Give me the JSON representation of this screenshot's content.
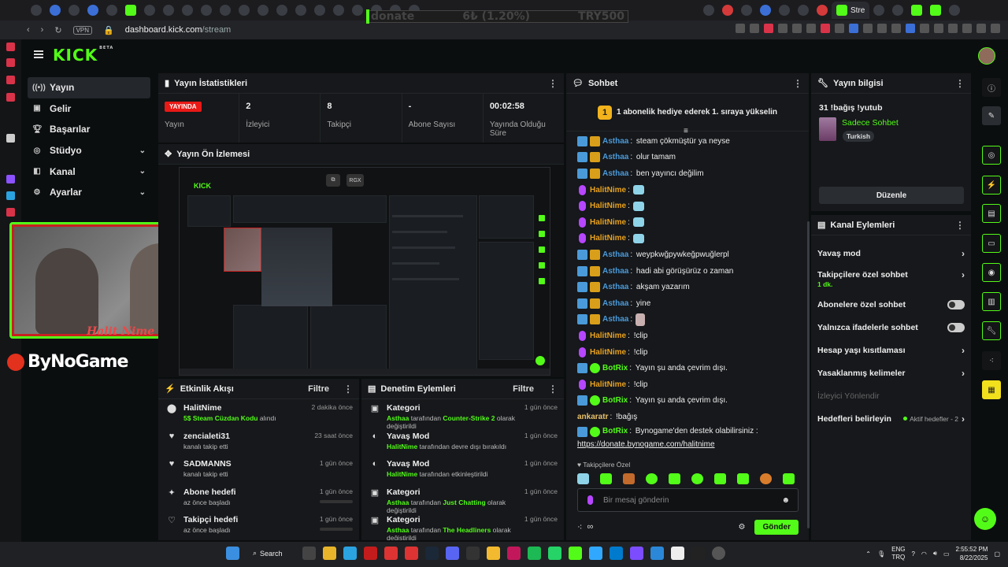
{
  "browser": {
    "donate_widget": {
      "label": "donate",
      "amount": "6₺ (1.20%)",
      "goal": "TRY500"
    },
    "active_tab_label": "Stre",
    "vpn_label": "VPN",
    "url_host": "dashboard.kick.com",
    "url_path": "/stream"
  },
  "header": {
    "logo_text": "KICK",
    "logo_badge": "BETA"
  },
  "nav": {
    "items": [
      {
        "label": "Yayın",
        "icon": "broadcast-icon"
      },
      {
        "label": "Gelir",
        "icon": "wallet-icon"
      },
      {
        "label": "Başarılar",
        "icon": "trophy-icon"
      },
      {
        "label": "Stüdyo",
        "icon": "studio-icon"
      },
      {
        "label": "Kanal",
        "icon": "channel-icon"
      },
      {
        "label": "Ayarlar",
        "icon": "gear-icon"
      }
    ]
  },
  "webcam": {
    "overlay_name": "Halit Nime"
  },
  "sponsor": {
    "text": "ByNoGame"
  },
  "stats_panel": {
    "title": "Yayın İstatistikleri",
    "live_badge": "YAYINDA",
    "stats": [
      {
        "value": "",
        "label": "Yayın"
      },
      {
        "value": "2",
        "label": "İzleyici"
      },
      {
        "value": "8",
        "label": "Takipçi"
      },
      {
        "value": "-",
        "label": "Abone Sayısı"
      },
      {
        "value": "00:02:58",
        "label": "Yayında Olduğu Süre"
      }
    ]
  },
  "preview_panel": {
    "title": "Yayın Ön İzlemesi",
    "overlay_btn": "RGX"
  },
  "activity_panel": {
    "title": "Etkinlik Akışı",
    "filter": "Filtre",
    "rows": [
      {
        "icon": "person-icon",
        "title": "HalitNime",
        "sub_strong": "5$ Steam Cüzdan Kodu",
        "sub": " alındı",
        "time": "2 dakika önce"
      },
      {
        "icon": "heart-icon",
        "title": "zencialeti31",
        "sub_strong": "",
        "sub": "kanalı takip etti",
        "time": "23 saat önce"
      },
      {
        "icon": "heart-icon",
        "title": "SADMANNS",
        "sub_strong": "",
        "sub": "kanalı takip etti",
        "time": "1 gün önce"
      },
      {
        "icon": "sparkle-icon",
        "title": "Abone hedefi",
        "sub_strong": "",
        "sub": "az önce başladı",
        "time": "1 gün önce"
      },
      {
        "icon": "heart-outline-icon",
        "title": "Takipçi hedefi",
        "sub_strong": "",
        "sub": "az önce başladı",
        "time": "1 gün önce"
      }
    ]
  },
  "moderation_panel": {
    "title": "Denetim Eylemleri",
    "filter": "Filtre",
    "rows": [
      {
        "title": "Kategori",
        "user": "Asthaa",
        "mid": " tarafından ",
        "strong": "Counter-Strike 2",
        "tail": " olarak değiştirildi",
        "time": "1 gün önce"
      },
      {
        "title": "Yavaş Mod",
        "user": "HalitNime",
        "mid": " tarafından devre dışı bırakıldı",
        "strong": "",
        "tail": "",
        "time": "1 gün önce"
      },
      {
        "title": "Yavaş Mod",
        "user": "HalitNime",
        "mid": " tarafından etkinleştirildi",
        "strong": "",
        "tail": "",
        "time": "1 gün önce"
      },
      {
        "title": "Kategori",
        "user": "Asthaa",
        "mid": " tarafından ",
        "strong": "Just Chatting",
        "tail": " olarak değiştirildi",
        "time": "1 gün önce"
      },
      {
        "title": "Kategori",
        "user": "Asthaa",
        "mid": " tarafından ",
        "strong": "The Headliners",
        "tail": " olarak değiştirildi",
        "time": "1 gün önce"
      }
    ]
  },
  "chat": {
    "title": "Sohbet",
    "gift_number": "1",
    "gift_text": "1 abonelik hediye ederek 1. sıraya yükselin",
    "messages": [
      {
        "user": "Asthaa",
        "text": "steam çökmüştür ya neyse"
      },
      {
        "user": "Asthaa",
        "text": "olur tamam"
      },
      {
        "user": "Asthaa",
        "text": "ben yayıncı değilim"
      },
      {
        "user": "HalitNime",
        "text": ""
      },
      {
        "user": "HalitNime",
        "text": ""
      },
      {
        "user": "HalitNime",
        "text": ""
      },
      {
        "user": "HalitNime",
        "text": ""
      },
      {
        "user": "Asthaa",
        "text": "weypkwğpywkeğpwuğlerpl"
      },
      {
        "user": "Asthaa",
        "text": "hadi abi görüşürüz o zaman"
      },
      {
        "user": "Asthaa",
        "text": "akşam yazarım"
      },
      {
        "user": "Asthaa",
        "text": "yine"
      },
      {
        "user": "Asthaa",
        "text": ""
      },
      {
        "user": "HalitNime",
        "text": "!clip"
      },
      {
        "user": "HalitNime",
        "text": "!clip"
      },
      {
        "user": "BotRix",
        "text": "Yayın şu anda çevrim dışı."
      },
      {
        "user": "HalitNime",
        "text": "!clip"
      },
      {
        "user": "BotRix",
        "text": "Yayın şu anda çevrim dışı."
      },
      {
        "user": "ankaratr",
        "text": "!bağış"
      },
      {
        "user": "BotRix",
        "text": "Bynogame'den destek olabilirsiniz :",
        "link": "https://donate.bynogame.com/halitnime"
      }
    ],
    "followers_only": "Takipçilere Özel",
    "input_placeholder": "Bir mesaj gönderin",
    "send_label": "Gönder"
  },
  "stream_info": {
    "title": "Yayın bilgisi",
    "stream_title": "31 !bağış !yutub",
    "category": "Sadece Sohbet",
    "tag": "Turkish",
    "edit_label": "Düzenle"
  },
  "channel_actions": {
    "title": "Kanal Eylemleri",
    "rows": [
      {
        "label": "Yavaş mod",
        "control": "chevron"
      },
      {
        "label": "Takipçilere özel sohbet",
        "sub": "1 dk.",
        "control": "chevron"
      },
      {
        "label": "Abonelere özel sohbet",
        "control": "toggle"
      },
      {
        "label": "Yalnızca ifadelerle sohbet",
        "control": "toggle"
      },
      {
        "label": "Hesap yaşı kısıtlaması",
        "control": "chevron"
      },
      {
        "label": "Yasaklanmış kelimeler",
        "control": "chevron"
      },
      {
        "label": "İzleyici Yönlendir",
        "control": "none"
      },
      {
        "label": "Hedefleri belirleyin",
        "goal": "Aktif hedefler - 2",
        "control": "chevron"
      }
    ]
  },
  "taskbar": {
    "search_label": "Search",
    "lang_top": "ENG",
    "lang_bottom": "TRQ",
    "time": "2:55:52 PM",
    "date": "8/22/2025"
  }
}
